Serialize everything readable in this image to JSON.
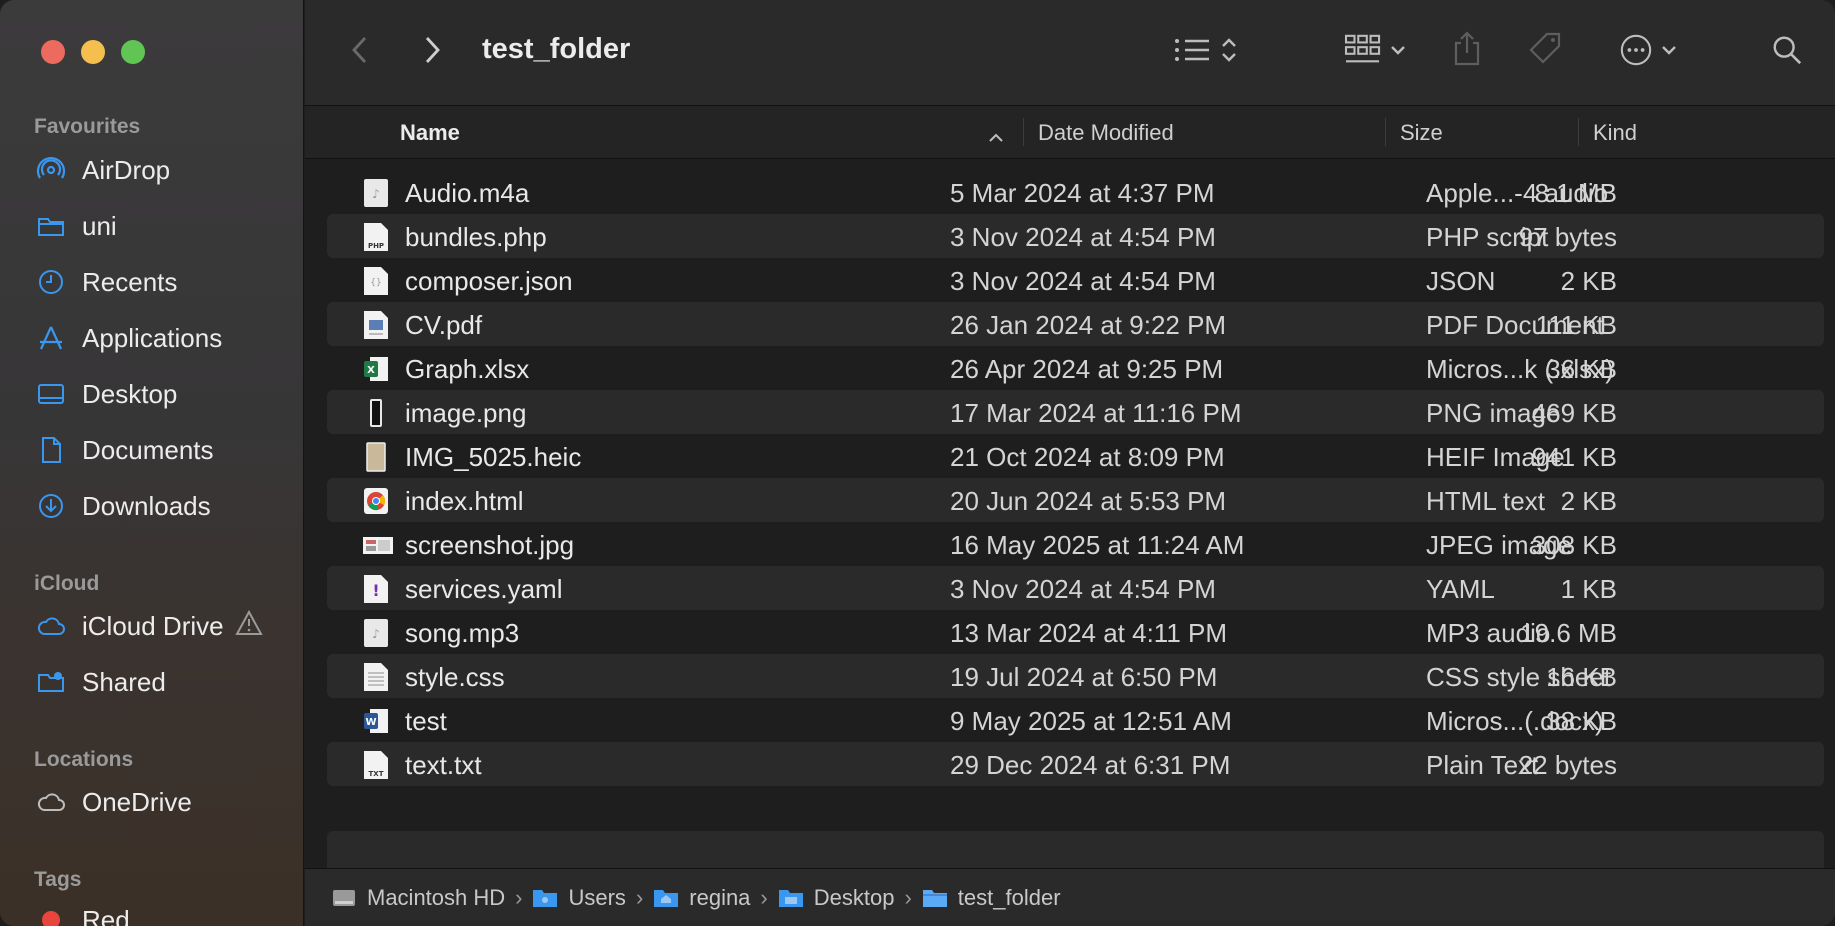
{
  "toolbar": {
    "title": "test_folder"
  },
  "sidebar": {
    "favourites_label": "Favourites",
    "favourites": [
      {
        "label": "AirDrop",
        "icon": "airdrop-icon"
      },
      {
        "label": "uni",
        "icon": "folder-icon"
      },
      {
        "label": "Recents",
        "icon": "clock-icon"
      },
      {
        "label": "Applications",
        "icon": "applications-icon"
      },
      {
        "label": "Desktop",
        "icon": "desktop-icon"
      },
      {
        "label": "Documents",
        "icon": "document-icon"
      },
      {
        "label": "Downloads",
        "icon": "download-icon"
      }
    ],
    "icloud_label": "iCloud",
    "icloud": [
      {
        "label": "iCloud Drive",
        "icon": "cloud-icon"
      },
      {
        "label": "Shared",
        "icon": "shared-folder-icon"
      }
    ],
    "locations_label": "Locations",
    "locations": [
      {
        "label": "OneDrive",
        "icon": "cloud-icon"
      }
    ],
    "tags_label": "Tags",
    "tags": [
      {
        "label": "Red",
        "color": "#e8453c"
      }
    ]
  },
  "columns": {
    "name": "Name",
    "date": "Date Modified",
    "size": "Size",
    "kind": "Kind"
  },
  "files": [
    {
      "name": "Audio.m4a",
      "date": "5 Mar 2024 at 4:37 PM",
      "size": "8.1 MB",
      "kind": "Apple...-4 audio",
      "icon": "audio-file-icon"
    },
    {
      "name": "bundles.php",
      "date": "3 Nov 2024 at 4:54 PM",
      "size": "97 bytes",
      "kind": "PHP script",
      "icon": "php-file-icon"
    },
    {
      "name": "composer.json",
      "date": "3 Nov 2024 at 4:54 PM",
      "size": "2 KB",
      "kind": "JSON",
      "icon": "json-file-icon"
    },
    {
      "name": "CV.pdf",
      "date": "26 Jan 2024 at 9:22 PM",
      "size": "111 KB",
      "kind": "PDF Document",
      "icon": "pdf-file-icon"
    },
    {
      "name": "Graph.xlsx",
      "date": "26 Apr 2024 at 9:25 PM",
      "size": "36 KB",
      "kind": "Micros...k (.xlsx)",
      "icon": "excel-file-icon"
    },
    {
      "name": "image.png",
      "date": "17 Mar 2024 at 11:16 PM",
      "size": "469 KB",
      "kind": "PNG image",
      "icon": "png-file-icon"
    },
    {
      "name": "IMG_5025.heic",
      "date": "21 Oct 2024 at 8:09 PM",
      "size": "941 KB",
      "kind": "HEIF Image",
      "icon": "heic-file-icon"
    },
    {
      "name": "index.html",
      "date": "20 Jun 2024 at 5:53 PM",
      "size": "2 KB",
      "kind": "HTML text",
      "icon": "chrome-html-icon"
    },
    {
      "name": "screenshot.jpg",
      "date": "16 May 2025 at 11:24 AM",
      "size": "308 KB",
      "kind": "JPEG image",
      "icon": "jpg-file-icon"
    },
    {
      "name": "services.yaml",
      "date": "3 Nov 2024 at 4:54 PM",
      "size": "1 KB",
      "kind": "YAML",
      "icon": "yaml-file-icon"
    },
    {
      "name": "song.mp3",
      "date": "13 Mar 2024 at 4:11 PM",
      "size": "19.6 MB",
      "kind": "MP3 audio",
      "icon": "audio-file-icon"
    },
    {
      "name": "style.css",
      "date": "19 Jul 2024 at 6:50 PM",
      "size": "16 KB",
      "kind": "CSS style sheet",
      "icon": "css-file-icon"
    },
    {
      "name": "test",
      "date": "9 May 2025 at 12:51 AM",
      "size": "38 KB",
      "kind": "Micros...(.docx)",
      "icon": "word-file-icon"
    },
    {
      "name": "text.txt",
      "date": "29 Dec 2024 at 6:31 PM",
      "size": "22 bytes",
      "kind": "Plain Text",
      "icon": "txt-file-icon"
    }
  ],
  "pathbar": [
    {
      "label": "Macintosh HD",
      "icon": "hard-drive-icon"
    },
    {
      "label": "Users",
      "icon": "folder-icon"
    },
    {
      "label": "regina",
      "icon": "home-folder-icon"
    },
    {
      "label": "Desktop",
      "icon": "folder-icon"
    },
    {
      "label": "test_folder",
      "icon": "folder-icon"
    }
  ],
  "colors": {
    "accent": "#3a97f0",
    "sidebar_icon": "#3a97f0"
  }
}
